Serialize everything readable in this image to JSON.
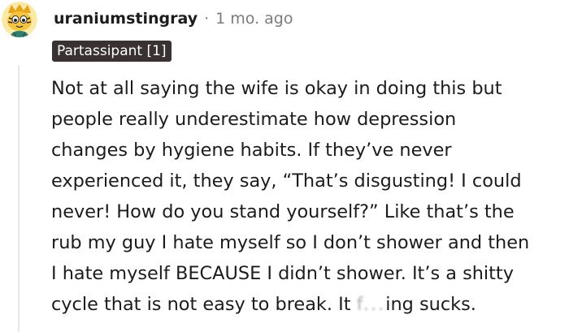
{
  "comment": {
    "avatar": "snoo-tiger-avatar",
    "username": "uraniumstingray",
    "separator": "·",
    "timestamp": "1 mo. ago",
    "flair": "Partassipant [1]",
    "body_lines": [
      "Not at all saying the wife is okay in doing this but",
      "people really underestimate how depression",
      "changes by hygiene habits. If they’ve never",
      "experienced it, they say, “That’s disgusting! I could",
      "never! How do you stand yourself?” Like that’s the",
      "rub my guy I hate myself so I don’t shower and then",
      "I hate myself BECAUSE I didn’t shower. It’s a shitty"
    ],
    "last_line": {
      "before": "cycle that is not easy to break. It ",
      "censored": "f...",
      "after": "ing sucks."
    }
  },
  "colors": {
    "text": "#1c1c1c",
    "meta": "#7c7c7c",
    "flair_bg": "#3a3232",
    "thread_line": "#e8e8e8"
  }
}
